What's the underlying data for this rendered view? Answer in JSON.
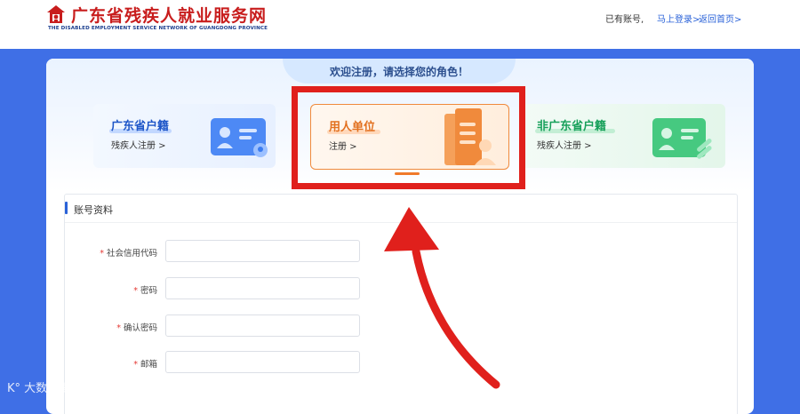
{
  "header": {
    "site_title": "广东省残疾人就业服务网",
    "site_subtitle": "THE DISABLED EMPLOYMENT SERVICE NETWORK OF GUANGDONG PROVINCE",
    "has_account": "已有账号,",
    "login_link": "马上登录>",
    "home_link": "返回首页>"
  },
  "welcome": "欢迎注册，请选择您的角色！",
  "roles": [
    {
      "title": "广东省户籍",
      "subtitle": "残疾人注册 >",
      "accent": "#1e56c8"
    },
    {
      "title": "用人单位",
      "subtitle": "注册 >",
      "accent": "#e2701f",
      "selected": true
    },
    {
      "title": "非广东省户籍",
      "subtitle": "残疾人注册 >",
      "accent": "#17a05a"
    }
  ],
  "section_title": "账号资料",
  "form": [
    {
      "label": "社会信用代码",
      "required": true,
      "value": ""
    },
    {
      "label": "密码",
      "required": true,
      "value": ""
    },
    {
      "label": "确认密码",
      "required": true,
      "value": ""
    },
    {
      "label": "邮箱",
      "required": true,
      "value": ""
    }
  ],
  "watermark": "大数跨境",
  "colors": {
    "page_bg": "#3f6fe6",
    "highlight": "#e0201c",
    "link": "#2a62d8",
    "required": "#e53935"
  }
}
